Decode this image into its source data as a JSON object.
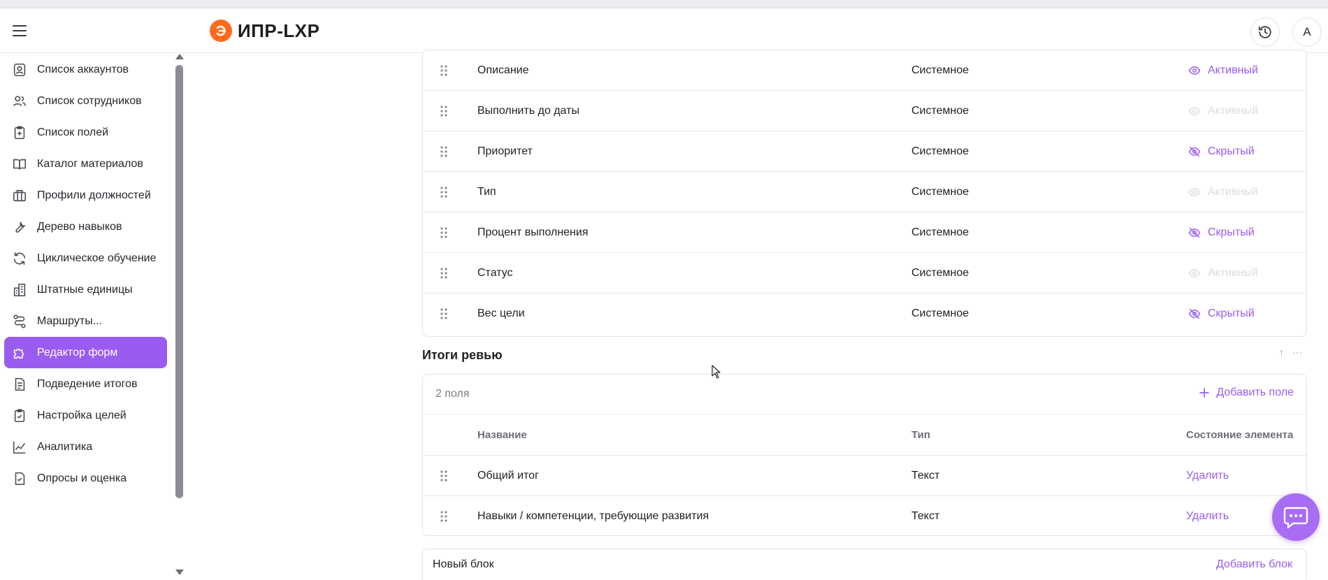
{
  "app": {
    "logo_text": "ИПР-LXP",
    "avatar_letter": "А"
  },
  "sidebar": {
    "items": [
      {
        "label": "Список аккаунтов",
        "icon": "account-list-icon",
        "active": false
      },
      {
        "label": "Список сотрудников",
        "icon": "users-icon",
        "active": false
      },
      {
        "label": "Список полей",
        "icon": "clipboard-plus-icon",
        "active": false
      },
      {
        "label": "Каталог материалов",
        "icon": "book-icon",
        "active": false
      },
      {
        "label": "Профили должностей",
        "icon": "briefcase-icon",
        "active": false
      },
      {
        "label": "Дерево навыков",
        "icon": "wrench-icon",
        "active": false
      },
      {
        "label": "Циклическое обучение",
        "icon": "refresh-icon",
        "active": false
      },
      {
        "label": "Штатные единицы",
        "icon": "building-icon",
        "active": false
      },
      {
        "label": "Маршруты...",
        "icon": "route-icon",
        "active": false
      },
      {
        "label": "Редактор форм",
        "icon": "puzzle-icon",
        "active": true
      },
      {
        "label": "Подведение итогов",
        "icon": "document-list-icon",
        "active": false
      },
      {
        "label": "Настройка целей",
        "icon": "clipboard-check-icon",
        "active": false
      },
      {
        "label": "Аналитика",
        "icon": "chart-line-icon",
        "active": false
      },
      {
        "label": "Опросы и оценка",
        "icon": "document-check-icon",
        "active": false
      }
    ]
  },
  "goals_table": {
    "rows": [
      {
        "name": "Описание",
        "type": "Системное",
        "state": "Активный",
        "state_kind": "active"
      },
      {
        "name": "Выполнить до даты",
        "type": "Системное",
        "state": "Активный",
        "state_kind": "disabled"
      },
      {
        "name": "Приоритет",
        "type": "Системное",
        "state": "Скрытый",
        "state_kind": "hidden"
      },
      {
        "name": "Тип",
        "type": "Системное",
        "state": "Активный",
        "state_kind": "disabled"
      },
      {
        "name": "Процент выполнения",
        "type": "Системное",
        "state": "Скрытый",
        "state_kind": "hidden"
      },
      {
        "name": "Статус",
        "type": "Системное",
        "state": "Активный",
        "state_kind": "disabled"
      },
      {
        "name": "Вес цели",
        "type": "Системное",
        "state": "Скрытый",
        "state_kind": "hidden"
      }
    ]
  },
  "review_section": {
    "title": "Итоги ревью",
    "count_label": "2 поля",
    "add_field_label": "Добавить поле",
    "headers": {
      "name": "Название",
      "type": "Тип",
      "state": "Состояние элемента"
    },
    "rows": [
      {
        "name": "Общий итог",
        "type": "Текст",
        "action": "Удалить"
      },
      {
        "name": "Навыки / компетенции, требующие развития",
        "type": "Текст",
        "action": "Удалить"
      }
    ]
  },
  "new_block": {
    "title": "Новый блок",
    "add_label": "Добавить блок"
  },
  "colors": {
    "accent": "#9a5cf0",
    "logo": "#ff6a1f",
    "disabled": "#dcdce2"
  }
}
